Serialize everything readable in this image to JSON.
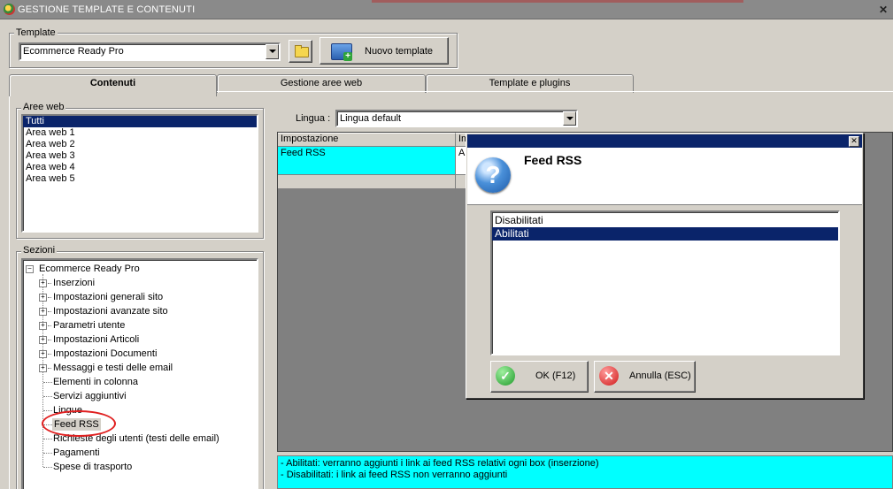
{
  "window": {
    "title": "GESTIONE TEMPLATE E CONTENUTI"
  },
  "template_group": {
    "legend": "Template",
    "combo_value": "Ecommerce Ready Pro",
    "folder_icon": "folder-icon",
    "new_button_label": "Nuovo template"
  },
  "tabs": [
    {
      "label": "Contenuti",
      "active": true
    },
    {
      "label": "Gestione aree web",
      "active": false
    },
    {
      "label": "Template e plugins",
      "active": false
    }
  ],
  "aree_web": {
    "legend": "Aree web",
    "items": [
      "Tutti",
      "Area web 1",
      "Area web 2",
      "Area web 3",
      "Area web 4",
      "Area web 5"
    ],
    "selected": "Tutti"
  },
  "sezioni": {
    "legend": "Sezioni",
    "root": "Ecommerce Ready Pro",
    "items": [
      {
        "label": "Inserzioni",
        "expandable": true
      },
      {
        "label": "Impostazioni generali sito",
        "expandable": true
      },
      {
        "label": "Impostazioni avanzate sito",
        "expandable": true
      },
      {
        "label": "Parametri utente",
        "expandable": true
      },
      {
        "label": "Impostazioni Articoli",
        "expandable": true
      },
      {
        "label": "Impostazioni Documenti",
        "expandable": true
      },
      {
        "label": "Messaggi e testi delle email",
        "expandable": true
      },
      {
        "label": "Elementi in colonna",
        "expandable": false
      },
      {
        "label": "Servizi aggiuntivi",
        "expandable": false
      },
      {
        "label": "Lingue",
        "expandable": false
      },
      {
        "label": "Feed RSS",
        "expandable": false,
        "selected": true
      },
      {
        "label": "Richieste degli utenti (testi delle email)",
        "expandable": false
      },
      {
        "label": "Pagamenti",
        "expandable": false
      },
      {
        "label": "Spese di trasporto",
        "expandable": false
      }
    ]
  },
  "lingua": {
    "label": "Lingua :",
    "value": "Lingua default"
  },
  "grid": {
    "headers": [
      "Impostazione",
      "Impostazione valore"
    ],
    "rows": [
      {
        "name": "Feed RSS",
        "value": "Abilitati"
      }
    ]
  },
  "description": {
    "lines": [
      "- Abilitati: verranno aggiunti i link ai feed RSS relativi ogni box (inserzione)",
      "- Disabilitati: i link ai feed RSS non verranno aggiunti"
    ]
  },
  "dialog": {
    "title": "Feed RSS",
    "icon": "question-icon",
    "options": [
      "Disabilitati",
      "Abilitati"
    ],
    "selected": "Abilitati",
    "ok_label": "OK (F12)",
    "cancel_label": "Annulla (ESC)"
  },
  "colors": {
    "highlight": "#0a246a",
    "cyan": "#00ffff",
    "annotation": "#e02020",
    "grid_bg": "#808080"
  }
}
